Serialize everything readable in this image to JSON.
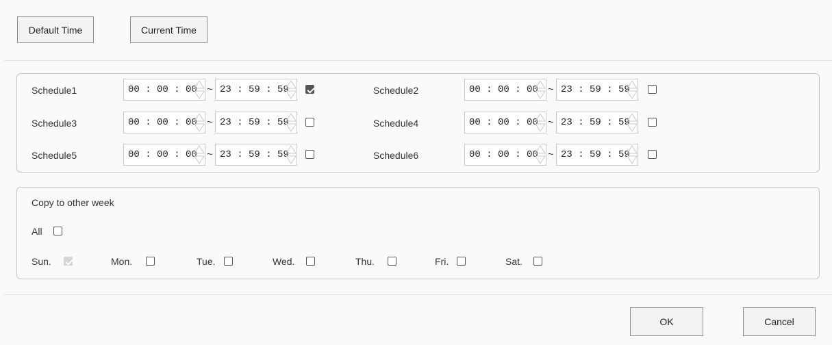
{
  "toolbar": {
    "default_time_label": "Default Time",
    "current_time_label": "Current Time"
  },
  "schedules": [
    {
      "label": "Schedule1",
      "start": "00 : 00 : 00",
      "end": "23 : 59 : 59",
      "enabled": true
    },
    {
      "label": "Schedule2",
      "start": "00 : 00 : 00",
      "end": "23 : 59 : 59",
      "enabled": false
    },
    {
      "label": "Schedule3",
      "start": "00 : 00 : 00",
      "end": "23 : 59 : 59",
      "enabled": false
    },
    {
      "label": "Schedule4",
      "start": "00 : 00 : 00",
      "end": "23 : 59 : 59",
      "enabled": false
    },
    {
      "label": "Schedule5",
      "start": "00 : 00 : 00",
      "end": "23 : 59 : 59",
      "enabled": false
    },
    {
      "label": "Schedule6",
      "start": "00 : 00 : 00",
      "end": "23 : 59 : 59",
      "enabled": false
    }
  ],
  "range_separator": "~",
  "copy": {
    "title": "Copy to other week",
    "all_label": "All",
    "all_checked": false,
    "days": [
      {
        "label": "Sun.",
        "checked": true,
        "disabled": true
      },
      {
        "label": "Mon.",
        "checked": false,
        "disabled": false
      },
      {
        "label": "Tue.",
        "checked": false,
        "disabled": false
      },
      {
        "label": "Wed.",
        "checked": false,
        "disabled": false
      },
      {
        "label": "Thu.",
        "checked": false,
        "disabled": false
      },
      {
        "label": "Fri.",
        "checked": false,
        "disabled": false
      },
      {
        "label": "Sat.",
        "checked": false,
        "disabled": false
      }
    ]
  },
  "footer": {
    "ok_label": "OK",
    "cancel_label": "Cancel"
  }
}
